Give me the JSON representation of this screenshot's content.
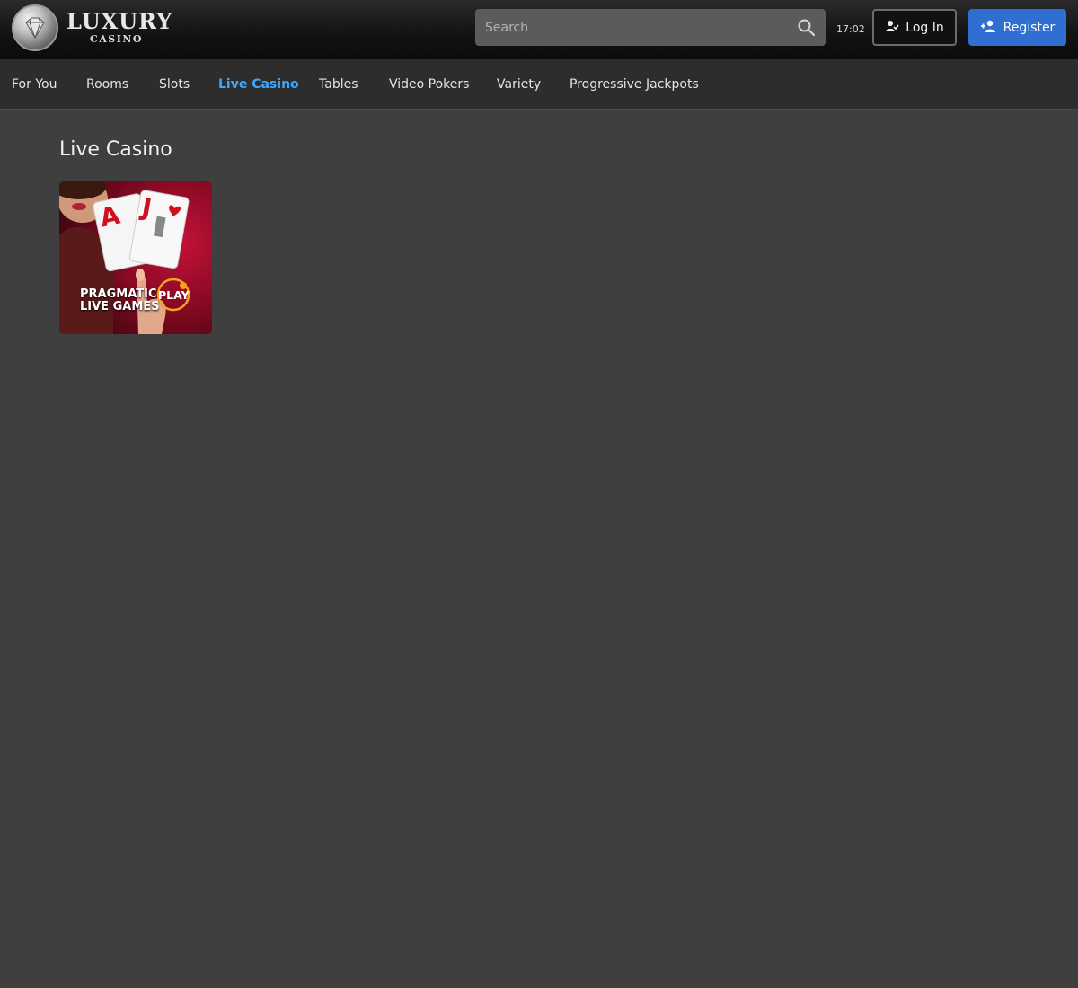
{
  "header": {
    "logo": {
      "title": "LUXURY",
      "subtitle": "CASINO"
    },
    "search": {
      "placeholder": "Search",
      "value": ""
    },
    "clock": "17:02",
    "login_label": "Log In",
    "register_label": "Register"
  },
  "nav": {
    "items": [
      {
        "label": "For You",
        "active": false
      },
      {
        "label": "Rooms",
        "active": false
      },
      {
        "label": "Slots",
        "active": false
      },
      {
        "label": "Live Casino",
        "active": true
      },
      {
        "label": "Tables",
        "active": false
      },
      {
        "label": "Video Pokers",
        "active": false
      },
      {
        "label": "Variety",
        "active": false
      },
      {
        "label": "Progressive Jackpots",
        "active": false
      }
    ]
  },
  "main": {
    "section_title": "Live Casino",
    "games": [
      {
        "provider_line1": "PRAGMATIC",
        "provider_line1b": "PLAY",
        "provider_line2": "LIVE GAMES",
        "card_ranks": [
          "A",
          "J"
        ]
      }
    ]
  },
  "colors": {
    "accent_active": "#3ea8ff",
    "register_bg": "#2f6fd1",
    "page_bg": "#3f3f3f",
    "nav_bg": "#2d2d2d"
  },
  "icons": [
    "diamond-icon",
    "search-icon",
    "user-check-icon",
    "user-add-icon",
    "pragmatic-play-icon"
  ]
}
